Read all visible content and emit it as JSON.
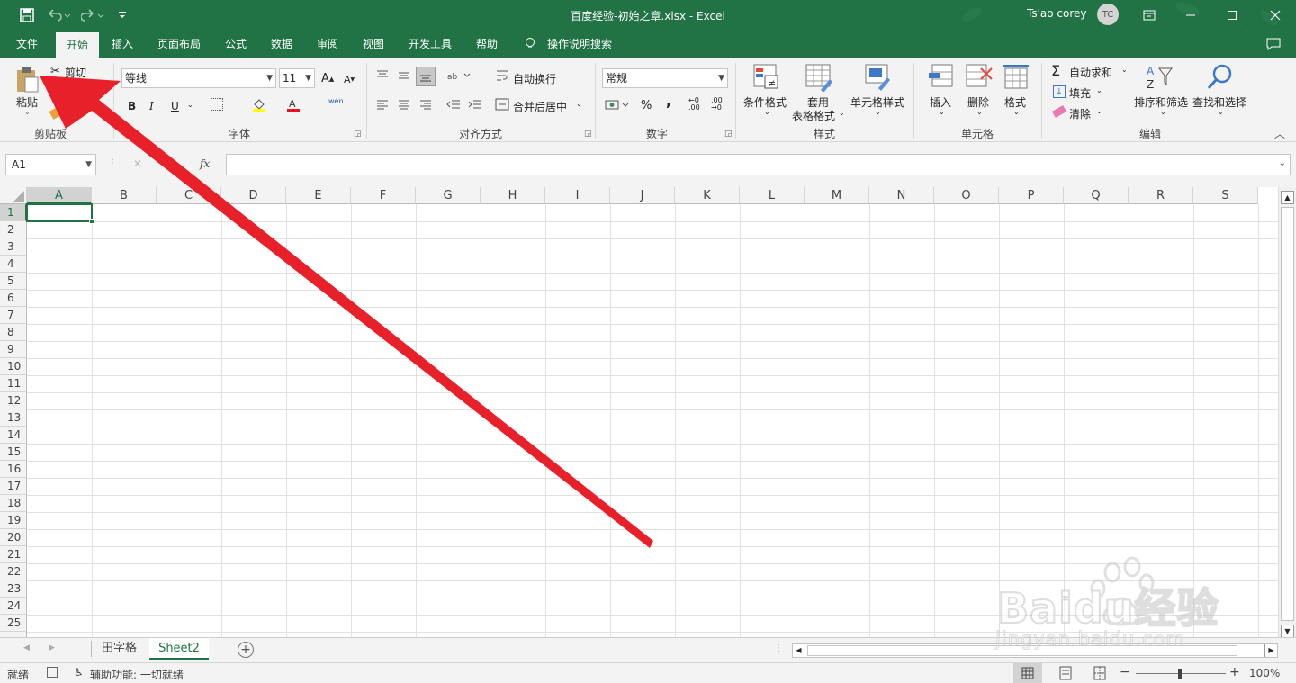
{
  "window": {
    "title": "百度经验-初始之章.xlsx  -  Excel",
    "user_name": "Ts'ao corey",
    "user_initials": "TC"
  },
  "tabs": [
    "文件",
    "开始",
    "插入",
    "页面布局",
    "公式",
    "数据",
    "审阅",
    "视图",
    "开发工具",
    "帮助"
  ],
  "tell_me": "操作说明搜索",
  "ribbon": {
    "clipboard": {
      "paste": "粘贴",
      "cut": "剪切",
      "label": "剪贴板"
    },
    "font": {
      "name": "等线",
      "size": "11",
      "label": "字体",
      "bold": "B",
      "italic": "I",
      "underline": "U",
      "phonetic": "wén"
    },
    "alignment": {
      "wrap": "自动换行",
      "merge": "合并后居中",
      "label": "对齐方式"
    },
    "number": {
      "format": "常规",
      "label": "数字",
      "percent": "%",
      "comma": ","
    },
    "styles": {
      "conditional": "条件格式",
      "table_1": "套用",
      "table_2": "表格格式",
      "cell_styles": "单元格样式",
      "label": "样式"
    },
    "cells": {
      "insert": "插入",
      "delete": "删除",
      "format": "格式",
      "label": "单元格"
    },
    "editing": {
      "autosum": "自动求和",
      "fill": "填充",
      "clear": "清除",
      "sort": "排序和筛选",
      "find": "查找和选择",
      "label": "编辑"
    }
  },
  "formula_bar": {
    "name_box": "A1",
    "fx": "fx",
    "formula": ""
  },
  "columns": [
    "A",
    "B",
    "C",
    "D",
    "E",
    "F",
    "G",
    "H",
    "I",
    "J",
    "K",
    "L",
    "M",
    "N",
    "O",
    "P",
    "Q",
    "R",
    "S"
  ],
  "rows": [
    "1",
    "2",
    "3",
    "4",
    "5",
    "6",
    "7",
    "8",
    "9",
    "10",
    "11",
    "12",
    "13",
    "14",
    "15",
    "16",
    "17",
    "18",
    "19",
    "20",
    "21",
    "22",
    "23",
    "24",
    "25"
  ],
  "sheets": [
    "田字格",
    "Sheet2"
  ],
  "status": {
    "ready": "就绪",
    "accessibility": "辅助功能: 一切就绪",
    "zoom": "100%"
  },
  "watermark": {
    "brand": "Baidu经验",
    "url": "jingyan.baidu.com"
  },
  "colors": {
    "excel_green": "#217346",
    "arrow_red": "#e8202a"
  }
}
